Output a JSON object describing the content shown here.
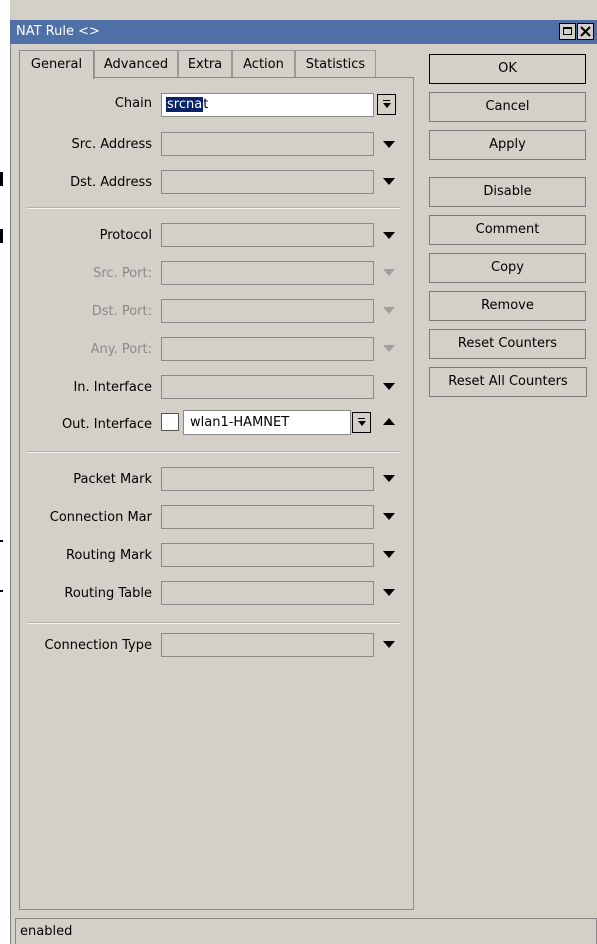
{
  "window": {
    "title": "NAT Rule <>"
  },
  "tabs": [
    {
      "label": "General",
      "active": true
    },
    {
      "label": "Advanced",
      "active": false
    },
    {
      "label": "Extra",
      "active": false
    },
    {
      "label": "Action",
      "active": false
    },
    {
      "label": "Statistics",
      "active": false
    }
  ],
  "fields": {
    "chain": {
      "label": "Chain",
      "value": "srcnat",
      "selected_text": "srcna",
      "rest_text": "t"
    },
    "src_address": {
      "label": "Src. Address",
      "value": ""
    },
    "dst_address": {
      "label": "Dst. Address",
      "value": ""
    },
    "protocol": {
      "label": "Protocol",
      "value": ""
    },
    "src_port": {
      "label": "Src. Port:",
      "value": "",
      "disabled": true
    },
    "dst_port": {
      "label": "Dst. Port:",
      "value": "",
      "disabled": true
    },
    "any_port": {
      "label": "Any. Port:",
      "value": "",
      "disabled": true
    },
    "in_interface": {
      "label": "In. Interface",
      "value": ""
    },
    "out_interface": {
      "label": "Out. Interface",
      "value": "wlan1-HAMNET",
      "negate": false
    },
    "packet_mark": {
      "label": "Packet Mark",
      "value": ""
    },
    "connection_mark": {
      "label": "Connection Mar",
      "value": ""
    },
    "routing_mark": {
      "label": "Routing Mark",
      "value": ""
    },
    "routing_table": {
      "label": "Routing Table",
      "value": ""
    },
    "connection_type": {
      "label": "Connection Type",
      "value": ""
    }
  },
  "buttons": {
    "ok": "OK",
    "cancel": "Cancel",
    "apply": "Apply",
    "disable": "Disable",
    "comment": "Comment",
    "copy": "Copy",
    "remove": "Remove",
    "reset_counters": "Reset Counters",
    "reset_all_counters": "Reset All Counters"
  },
  "status": "enabled",
  "colors": {
    "titlebar": "#4f6fa7",
    "window_bg": "#d4d0c8",
    "selection": "#0a246a"
  }
}
